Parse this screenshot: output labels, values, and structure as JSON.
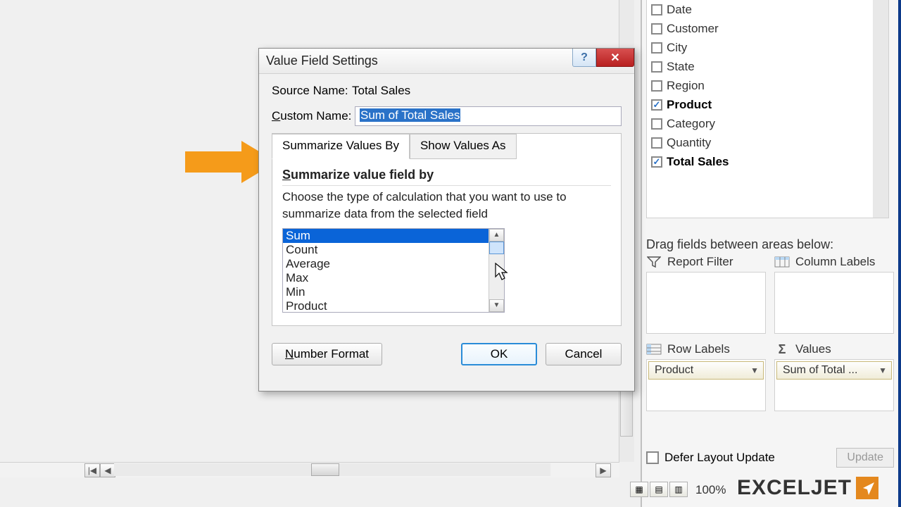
{
  "dialog": {
    "title": "Value Field Settings",
    "source_label": "Source Name:",
    "source_value": "Total Sales",
    "custom_label_pre": "C",
    "custom_label_post": "ustom Name:",
    "custom_value": "Sum of Total Sales",
    "tabs": {
      "summarize": "Summarize Values By",
      "show_as": "Show Values As"
    },
    "section_title_pre": "S",
    "section_title_post": "ummarize value field by",
    "section_desc": "Choose the type of calculation that you want to use to summarize data from the selected field",
    "calc_options": [
      "Sum",
      "Count",
      "Average",
      "Max",
      "Min",
      "Product"
    ],
    "number_format_pre": "N",
    "number_format_post": "umber Format",
    "ok": "OK",
    "cancel": "Cancel"
  },
  "field_list": [
    {
      "label": "Date",
      "checked": false,
      "bold": false
    },
    {
      "label": "Customer",
      "checked": false,
      "bold": false
    },
    {
      "label": "City",
      "checked": false,
      "bold": false
    },
    {
      "label": "State",
      "checked": false,
      "bold": false
    },
    {
      "label": "Region",
      "checked": false,
      "bold": false
    },
    {
      "label": "Product",
      "checked": true,
      "bold": true
    },
    {
      "label": "Category",
      "checked": false,
      "bold": false
    },
    {
      "label": "Quantity",
      "checked": false,
      "bold": false
    },
    {
      "label": "Total Sales",
      "checked": true,
      "bold": true
    }
  ],
  "drag_label": "Drag fields between areas below:",
  "areas": {
    "report_filter": "Report Filter",
    "column_labels": "Column Labels",
    "row_labels": "Row Labels",
    "values": "Values",
    "row_pill": "Product",
    "values_pill": "Sum of Total ..."
  },
  "defer": {
    "label": "Defer Layout Update",
    "update": "Update"
  },
  "zoom": "100%",
  "brand": "EXCELJET"
}
